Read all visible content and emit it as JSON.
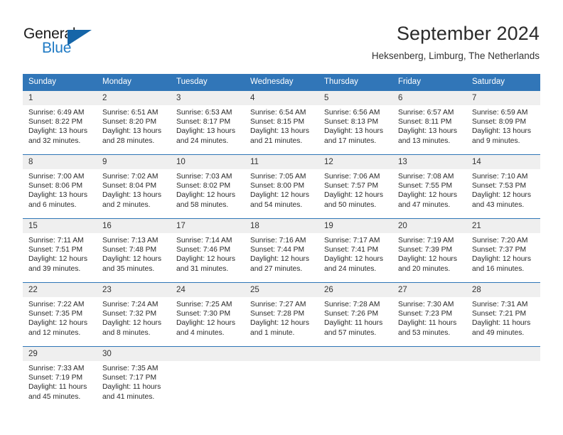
{
  "brand": {
    "name_part1": "General",
    "name_part2": "Blue",
    "accent_color": "#1f7ac4",
    "triangle_color": "#1565a8"
  },
  "header": {
    "title": "September 2024",
    "subtitle": "Heksenberg, Limburg, The Netherlands",
    "header_bg_color": "#3176b8",
    "row_border_color": "#2e75b6",
    "daynum_bg_color": "#efefef"
  },
  "weekdays": [
    "Sunday",
    "Monday",
    "Tuesday",
    "Wednesday",
    "Thursday",
    "Friday",
    "Saturday"
  ],
  "labels": {
    "sunrise": "Sunrise:",
    "sunset": "Sunset:",
    "daylight": "Daylight:"
  },
  "weeks": [
    [
      {
        "day": "1",
        "sunrise": "Sunrise: 6:49 AM",
        "sunset": "Sunset: 8:22 PM",
        "daylight_line1": "Daylight: 13 hours",
        "daylight_line2": "and 32 minutes."
      },
      {
        "day": "2",
        "sunrise": "Sunrise: 6:51 AM",
        "sunset": "Sunset: 8:20 PM",
        "daylight_line1": "Daylight: 13 hours",
        "daylight_line2": "and 28 minutes."
      },
      {
        "day": "3",
        "sunrise": "Sunrise: 6:53 AM",
        "sunset": "Sunset: 8:17 PM",
        "daylight_line1": "Daylight: 13 hours",
        "daylight_line2": "and 24 minutes."
      },
      {
        "day": "4",
        "sunrise": "Sunrise: 6:54 AM",
        "sunset": "Sunset: 8:15 PM",
        "daylight_line1": "Daylight: 13 hours",
        "daylight_line2": "and 21 minutes."
      },
      {
        "day": "5",
        "sunrise": "Sunrise: 6:56 AM",
        "sunset": "Sunset: 8:13 PM",
        "daylight_line1": "Daylight: 13 hours",
        "daylight_line2": "and 17 minutes."
      },
      {
        "day": "6",
        "sunrise": "Sunrise: 6:57 AM",
        "sunset": "Sunset: 8:11 PM",
        "daylight_line1": "Daylight: 13 hours",
        "daylight_line2": "and 13 minutes."
      },
      {
        "day": "7",
        "sunrise": "Sunrise: 6:59 AM",
        "sunset": "Sunset: 8:09 PM",
        "daylight_line1": "Daylight: 13 hours",
        "daylight_line2": "and 9 minutes."
      }
    ],
    [
      {
        "day": "8",
        "sunrise": "Sunrise: 7:00 AM",
        "sunset": "Sunset: 8:06 PM",
        "daylight_line1": "Daylight: 13 hours",
        "daylight_line2": "and 6 minutes."
      },
      {
        "day": "9",
        "sunrise": "Sunrise: 7:02 AM",
        "sunset": "Sunset: 8:04 PM",
        "daylight_line1": "Daylight: 13 hours",
        "daylight_line2": "and 2 minutes."
      },
      {
        "day": "10",
        "sunrise": "Sunrise: 7:03 AM",
        "sunset": "Sunset: 8:02 PM",
        "daylight_line1": "Daylight: 12 hours",
        "daylight_line2": "and 58 minutes."
      },
      {
        "day": "11",
        "sunrise": "Sunrise: 7:05 AM",
        "sunset": "Sunset: 8:00 PM",
        "daylight_line1": "Daylight: 12 hours",
        "daylight_line2": "and 54 minutes."
      },
      {
        "day": "12",
        "sunrise": "Sunrise: 7:06 AM",
        "sunset": "Sunset: 7:57 PM",
        "daylight_line1": "Daylight: 12 hours",
        "daylight_line2": "and 50 minutes."
      },
      {
        "day": "13",
        "sunrise": "Sunrise: 7:08 AM",
        "sunset": "Sunset: 7:55 PM",
        "daylight_line1": "Daylight: 12 hours",
        "daylight_line2": "and 47 minutes."
      },
      {
        "day": "14",
        "sunrise": "Sunrise: 7:10 AM",
        "sunset": "Sunset: 7:53 PM",
        "daylight_line1": "Daylight: 12 hours",
        "daylight_line2": "and 43 minutes."
      }
    ],
    [
      {
        "day": "15",
        "sunrise": "Sunrise: 7:11 AM",
        "sunset": "Sunset: 7:51 PM",
        "daylight_line1": "Daylight: 12 hours",
        "daylight_line2": "and 39 minutes."
      },
      {
        "day": "16",
        "sunrise": "Sunrise: 7:13 AM",
        "sunset": "Sunset: 7:48 PM",
        "daylight_line1": "Daylight: 12 hours",
        "daylight_line2": "and 35 minutes."
      },
      {
        "day": "17",
        "sunrise": "Sunrise: 7:14 AM",
        "sunset": "Sunset: 7:46 PM",
        "daylight_line1": "Daylight: 12 hours",
        "daylight_line2": "and 31 minutes."
      },
      {
        "day": "18",
        "sunrise": "Sunrise: 7:16 AM",
        "sunset": "Sunset: 7:44 PM",
        "daylight_line1": "Daylight: 12 hours",
        "daylight_line2": "and 27 minutes."
      },
      {
        "day": "19",
        "sunrise": "Sunrise: 7:17 AM",
        "sunset": "Sunset: 7:41 PM",
        "daylight_line1": "Daylight: 12 hours",
        "daylight_line2": "and 24 minutes."
      },
      {
        "day": "20",
        "sunrise": "Sunrise: 7:19 AM",
        "sunset": "Sunset: 7:39 PM",
        "daylight_line1": "Daylight: 12 hours",
        "daylight_line2": "and 20 minutes."
      },
      {
        "day": "21",
        "sunrise": "Sunrise: 7:20 AM",
        "sunset": "Sunset: 7:37 PM",
        "daylight_line1": "Daylight: 12 hours",
        "daylight_line2": "and 16 minutes."
      }
    ],
    [
      {
        "day": "22",
        "sunrise": "Sunrise: 7:22 AM",
        "sunset": "Sunset: 7:35 PM",
        "daylight_line1": "Daylight: 12 hours",
        "daylight_line2": "and 12 minutes."
      },
      {
        "day": "23",
        "sunrise": "Sunrise: 7:24 AM",
        "sunset": "Sunset: 7:32 PM",
        "daylight_line1": "Daylight: 12 hours",
        "daylight_line2": "and 8 minutes."
      },
      {
        "day": "24",
        "sunrise": "Sunrise: 7:25 AM",
        "sunset": "Sunset: 7:30 PM",
        "daylight_line1": "Daylight: 12 hours",
        "daylight_line2": "and 4 minutes."
      },
      {
        "day": "25",
        "sunrise": "Sunrise: 7:27 AM",
        "sunset": "Sunset: 7:28 PM",
        "daylight_line1": "Daylight: 12 hours",
        "daylight_line2": "and 1 minute."
      },
      {
        "day": "26",
        "sunrise": "Sunrise: 7:28 AM",
        "sunset": "Sunset: 7:26 PM",
        "daylight_line1": "Daylight: 11 hours",
        "daylight_line2": "and 57 minutes."
      },
      {
        "day": "27",
        "sunrise": "Sunrise: 7:30 AM",
        "sunset": "Sunset: 7:23 PM",
        "daylight_line1": "Daylight: 11 hours",
        "daylight_line2": "and 53 minutes."
      },
      {
        "day": "28",
        "sunrise": "Sunrise: 7:31 AM",
        "sunset": "Sunset: 7:21 PM",
        "daylight_line1": "Daylight: 11 hours",
        "daylight_line2": "and 49 minutes."
      }
    ],
    [
      {
        "day": "29",
        "sunrise": "Sunrise: 7:33 AM",
        "sunset": "Sunset: 7:19 PM",
        "daylight_line1": "Daylight: 11 hours",
        "daylight_line2": "and 45 minutes."
      },
      {
        "day": "30",
        "sunrise": "Sunrise: 7:35 AM",
        "sunset": "Sunset: 7:17 PM",
        "daylight_line1": "Daylight: 11 hours",
        "daylight_line2": "and 41 minutes."
      },
      {
        "day": "",
        "sunrise": "",
        "sunset": "",
        "daylight_line1": "",
        "daylight_line2": ""
      },
      {
        "day": "",
        "sunrise": "",
        "sunset": "",
        "daylight_line1": "",
        "daylight_line2": ""
      },
      {
        "day": "",
        "sunrise": "",
        "sunset": "",
        "daylight_line1": "",
        "daylight_line2": ""
      },
      {
        "day": "",
        "sunrise": "",
        "sunset": "",
        "daylight_line1": "",
        "daylight_line2": ""
      },
      {
        "day": "",
        "sunrise": "",
        "sunset": "",
        "daylight_line1": "",
        "daylight_line2": ""
      }
    ]
  ]
}
